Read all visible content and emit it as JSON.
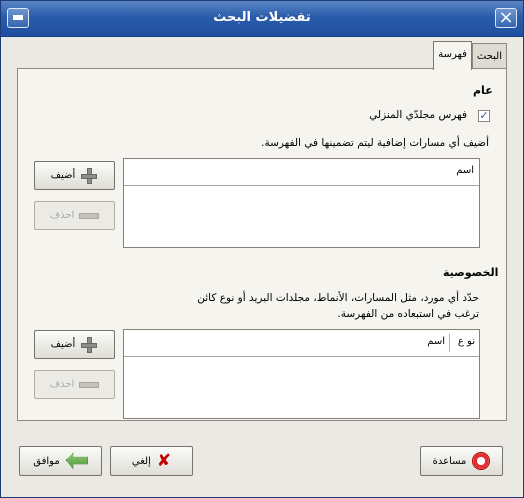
{
  "window": {
    "title": "تفضيلات البحث"
  },
  "tabs": [
    {
      "label": "البحث",
      "active": false
    },
    {
      "label": "فهرسة",
      "active": true
    }
  ],
  "general": {
    "heading": "عام",
    "checkbox_label": "فهرس مجلدّي المنزلي",
    "checked": true,
    "description": "أضيف أي مسارات إضافية ليتم تضمينها في الفهرسة."
  },
  "paths_list": {
    "header_name": "اسم",
    "rows": []
  },
  "privacy": {
    "heading": "الخصوصية",
    "description_line1": "حدّد أي مورد، مثل المسارات، الأنماط، مجلدات البريد أو نوع كائن",
    "description_line2": "ترغب في استبعاده من الفهرسة."
  },
  "exclude_list": {
    "header_type": "نو ع",
    "header_name": "اسم",
    "rows": []
  },
  "buttons": {
    "add": "أضيف",
    "remove": "احذف",
    "help": "مساعدة",
    "cancel": "إلغي",
    "ok": "موافق"
  },
  "colors": {
    "title_bar": "#2a5cab",
    "background": "#ebe9e3"
  }
}
